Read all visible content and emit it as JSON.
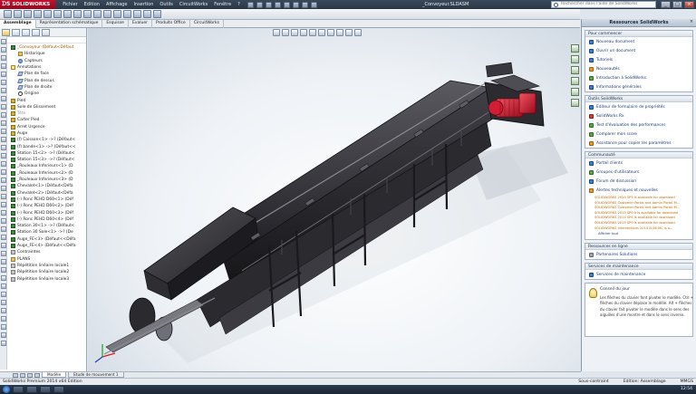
{
  "app": {
    "brand": "SOLIDWORKS",
    "document_title": "_Convoyeur.SLDASM",
    "search_placeholder": "Rechercher dans l'aide de SolidWorks",
    "menu": [
      "Fichier",
      "Edition",
      "Affichage",
      "Insertion",
      "Outils",
      "CircuitWorks",
      "Fenêtre",
      "?"
    ],
    "window_buttons": [
      "_",
      "□",
      "×"
    ]
  },
  "command_tabs": [
    "Assemblage",
    "Représentation schématique",
    "Esquisse",
    "Evaluer",
    "Produits Office",
    "CircuitWorks"
  ],
  "feature_tree": {
    "root_label": "_Convoyeur (Défaut<Défaut",
    "items": [
      {
        "label": "Historique",
        "icon": "folder",
        "indent": 2
      },
      {
        "label": "Capteurs",
        "icon": "sensor",
        "indent": 2
      },
      {
        "label": "Annotations",
        "icon": "note",
        "indent": 1
      },
      {
        "label": "Plan de face",
        "icon": "plane",
        "indent": 2
      },
      {
        "label": "Plan de dessus",
        "icon": "plane",
        "indent": 2
      },
      {
        "label": "Plan de droite",
        "icon": "plane",
        "indent": 2
      },
      {
        "label": "Origine",
        "icon": "origin",
        "indent": 2
      },
      {
        "label": "Pied",
        "icon": "part",
        "indent": 1
      },
      {
        "label": "Sole de Glissement",
        "icon": "part",
        "indent": 1
      },
      {
        "label": "Tête",
        "icon": "part",
        "indent": 1,
        "dim": true
      },
      {
        "label": "Carter Pied",
        "icon": "part",
        "indent": 1
      },
      {
        "label": "Arret Urgence",
        "icon": "part",
        "indent": 1
      },
      {
        "label": "Auge",
        "icon": "part",
        "indent": 1
      },
      {
        "label": "(f) Caisson<1> ->? (Défaut<",
        "icon": "asm",
        "indent": 1
      },
      {
        "label": "(f) bande<1> ->? (Défaut<<",
        "icon": "asm",
        "indent": 1
      },
      {
        "label": "Station 15<2> ->? (Défaut<",
        "icon": "asm",
        "indent": 1
      },
      {
        "label": "Station 15<3> ->? (Défaut<",
        "icon": "asm",
        "indent": 1
      },
      {
        "label": "_Rouleaux Inferieurs<1> (D",
        "icon": "asm",
        "indent": 1
      },
      {
        "label": "_Rouleaux Inferieurs<2> (D",
        "icon": "asm",
        "indent": 1
      },
      {
        "label": "_Rouleaux Inferieurs<3> (D",
        "icon": "asm",
        "indent": 1
      },
      {
        "label": "Chevalet<1> (Défaut<Défa",
        "icon": "asm",
        "indent": 1
      },
      {
        "label": "Chevalet<2> (Défaut<Défa",
        "icon": "asm",
        "indent": 1
      },
      {
        "label": "(-) Ronc PEHD D60<1> (Déf",
        "icon": "asm",
        "indent": 1
      },
      {
        "label": "(-) Ronc PEHD D60<2> (Déf",
        "icon": "asm",
        "indent": 1
      },
      {
        "label": "(-) Ronc PEHD D60<3> (Déf",
        "icon": "asm",
        "indent": 1
      },
      {
        "label": "(-) Ronc PEHD D60<4> (Déf",
        "icon": "asm",
        "indent": 1
      },
      {
        "label": "Station 30<1> ->? (Défaut<",
        "icon": "asm",
        "indent": 1
      },
      {
        "label": "Station 30 Sole<1> ->? (De",
        "icon": "asm",
        "indent": 1
      },
      {
        "label": "Auge_FE<3> (Défaut<<Défa",
        "icon": "asm",
        "indent": 1
      },
      {
        "label": "Auge_FE<4> (Défaut<<Défa",
        "icon": "asm",
        "indent": 1
      },
      {
        "label": "Contraintes",
        "icon": "gray",
        "indent": 1
      },
      {
        "label": "PLANS",
        "icon": "folder",
        "indent": 1
      },
      {
        "label": "Répétition linéaire locale1",
        "icon": "gray",
        "indent": 1
      },
      {
        "label": "Répétition linéaire locale2",
        "icon": "gray",
        "indent": 1
      },
      {
        "label": "Répétition linéaire locale3",
        "icon": "gray",
        "indent": 1
      }
    ]
  },
  "task_pane": {
    "title": "Ressources SolidWorks",
    "sections": [
      {
        "title": "Pour commencer",
        "links": [
          {
            "label": "Nouveau document",
            "icon": "blue"
          },
          {
            "label": "Ouvrir un document",
            "icon": "blue"
          },
          {
            "label": "Tutoriels",
            "icon": "blue"
          },
          {
            "label": "Nouveautés",
            "icon": "orange"
          },
          {
            "label": "Introduction à SolidWorks",
            "icon": "green"
          },
          {
            "label": "Informations générales",
            "icon": "blue"
          }
        ]
      },
      {
        "title": "Outils SolidWorks",
        "links": [
          {
            "label": "Editeur de formulaire de propriétés",
            "icon": "blue"
          },
          {
            "label": "SolidWorks Rx",
            "icon": "red"
          },
          {
            "label": "Test d'évaluation des performances",
            "icon": "green"
          },
          {
            "label": "Comparer mon score",
            "icon": "green"
          },
          {
            "label": "Assistance pour copier les paramètres",
            "icon": "orange"
          }
        ]
      },
      {
        "title": "Communauté",
        "links": [
          {
            "label": "Portail clients",
            "icon": "blue"
          },
          {
            "label": "Groupes d'utilisateurs",
            "icon": "green"
          },
          {
            "label": "Forum de discussion",
            "icon": "blue"
          },
          {
            "label": "Alertes techniques et nouvelles",
            "icon": "orange"
          }
        ],
        "news": [
          "SOLIDWORKS 2014 SP5 is available for download",
          "SOLIDWORKS Customer Portal and Admin Portal M...",
          "SOLIDWORKS Customer Portal and Admin Portal M...",
          "SOLIDWORKS 2015 SP0.0 is available for download",
          "SOLIDWORKS 2014 SP4 is available for download",
          "SOLIDWORKS 2015 SP0 is available for download",
          "SOLIDWORKS Intersections 2014 N.08-MC is a..."
        ],
        "more": "Afficher tout"
      },
      {
        "title": "Ressources en ligne",
        "links": [
          {
            "label": "Partenaires Solutions",
            "icon": "gray"
          }
        ]
      },
      {
        "title": "Services de maintenance",
        "links": [
          {
            "label": "Services de maintenance",
            "icon": "blue"
          }
        ]
      }
    ],
    "tip": {
      "title": "Conseil du jour",
      "text": "Les flèches du clavier font pivoter le modèle. Ctrl + flèches du clavier déplace le modèle. Alt + flèches du clavier fait pivoter le modèle dans le sens des aiguilles d'une montre et dans le sens inverse."
    }
  },
  "bottom_tabs": [
    "Modèle",
    "Etude de mouvement 1"
  ],
  "status": {
    "left": "SolidWorks Premium 2014 x64 Edition",
    "state": "Sous-contraint",
    "mode": "Edition: Assemblage",
    "units": "MMGS"
  },
  "clock": "12:54",
  "colors": {
    "conveyor_frame": "#2e2e32",
    "motor": "#c8102e",
    "accent": "#1a3c78"
  }
}
